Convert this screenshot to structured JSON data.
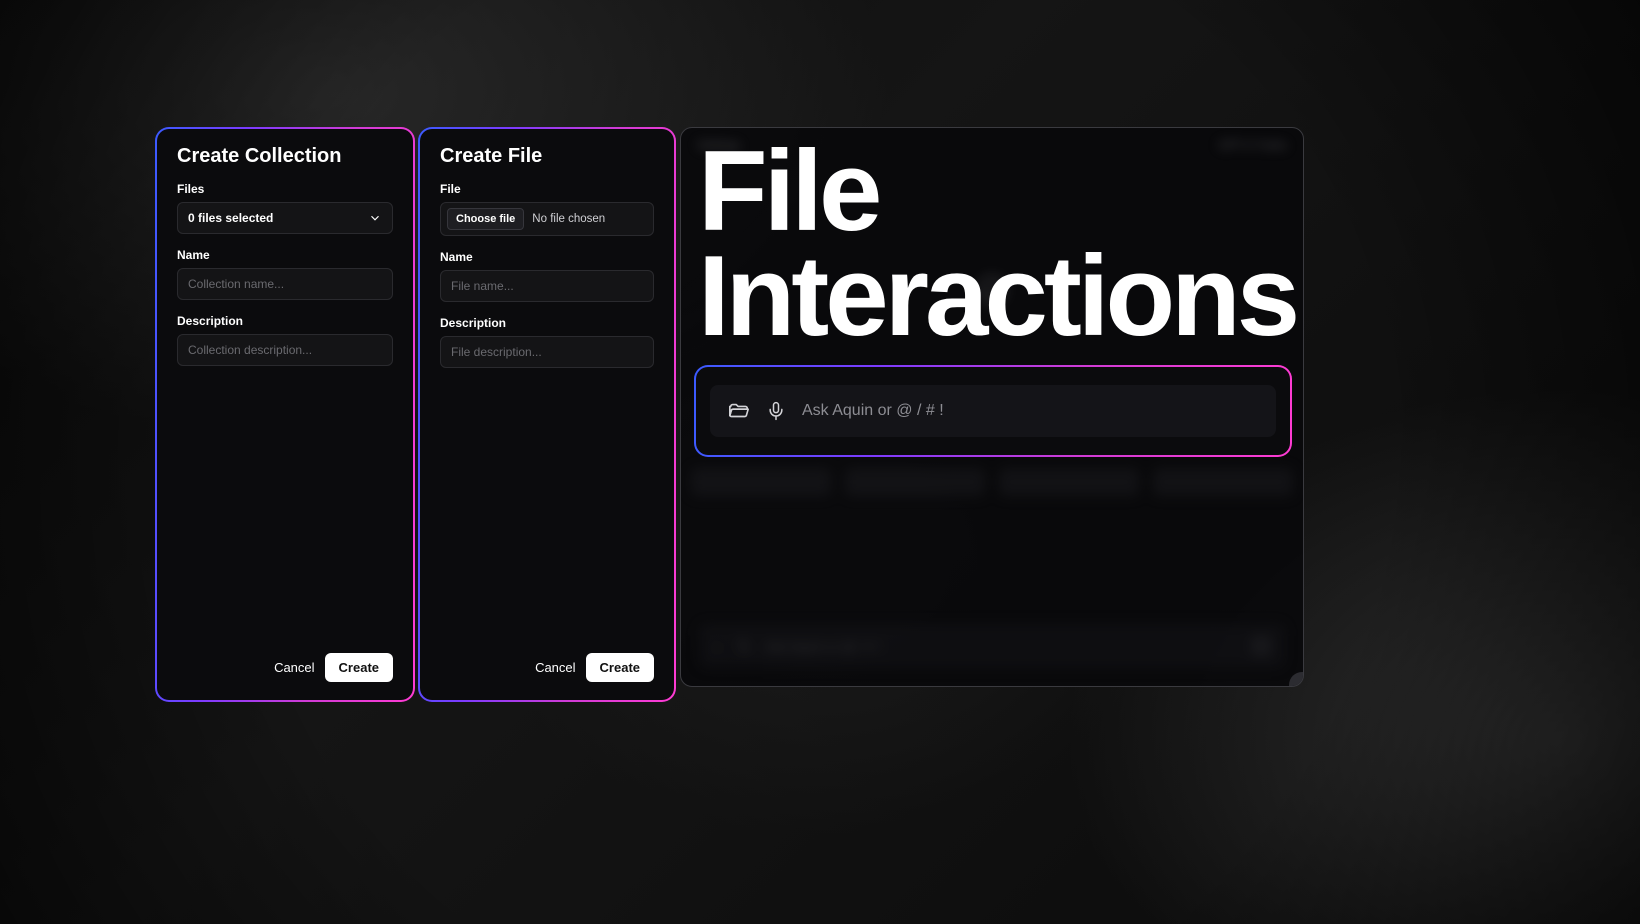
{
  "hero": {
    "line1": "File",
    "line2": "Interactions"
  },
  "collection_panel": {
    "title": "Create Collection",
    "files_label": "Files",
    "files_selected_text": "0 files selected",
    "name_label": "Name",
    "name_placeholder": "Collection name...",
    "description_label": "Description",
    "description_placeholder": "Collection description...",
    "cancel_label": "Cancel",
    "create_label": "Create"
  },
  "file_panel": {
    "title": "Create File",
    "file_label": "File",
    "choose_btn": "Choose file",
    "no_file_text": "No file chosen",
    "name_label": "Name",
    "name_placeholder": "File name...",
    "description_label": "Description",
    "description_placeholder": "File description...",
    "cancel_label": "Cancel",
    "create_label": "Create"
  },
  "chat_input": {
    "placeholder": "Ask Aquin or @  /  #  !"
  },
  "app_window": {
    "top_left": "Settings",
    "model_label": "GPT-4 Turbo",
    "bottom_placeholder": "Ask Aquin or @ / # !"
  }
}
